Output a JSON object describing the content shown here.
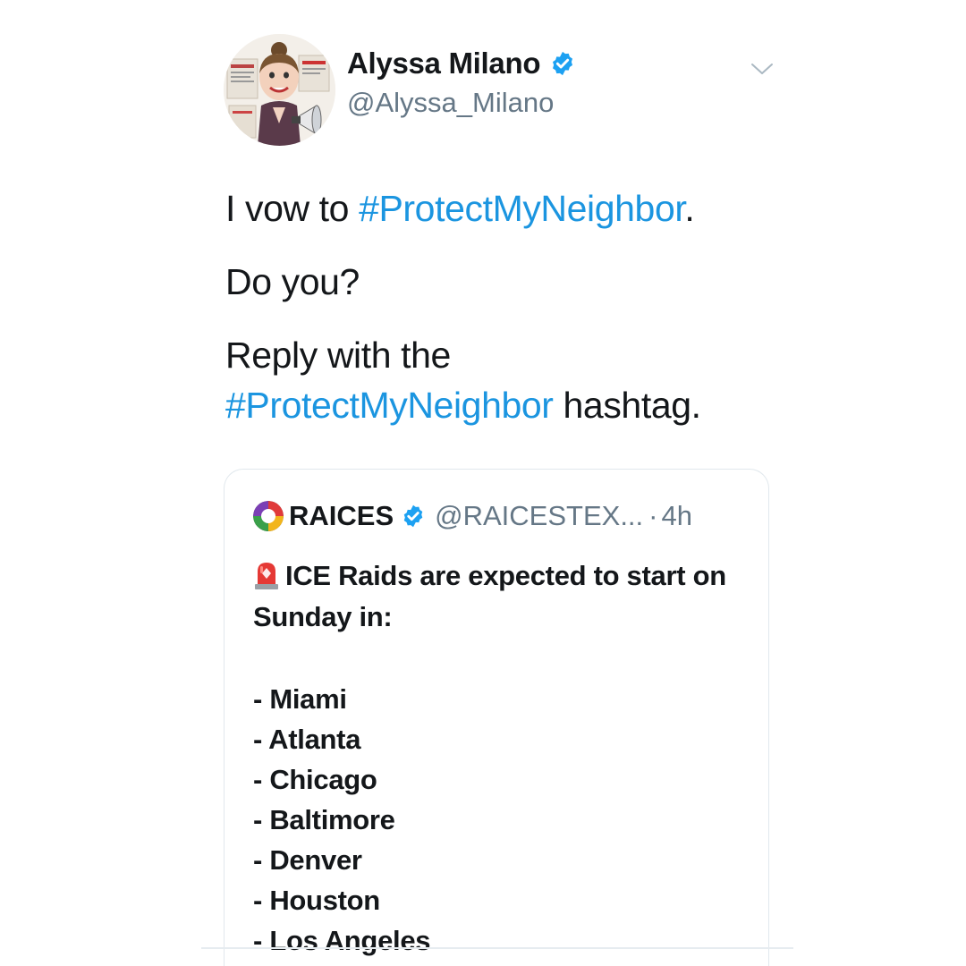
{
  "tweet": {
    "author": {
      "display_name": "Alyssa Milano",
      "handle": "@Alyssa_Milano",
      "avatar_icon": "cartoon-caricature-avatar",
      "verified_icon": "verified-badge-icon"
    },
    "menu_icon": "chevron-down-icon",
    "lines": [
      {
        "before": "I vow to ",
        "hashtag": "#ProtectMyNeighbor",
        "after": "."
      },
      {
        "text": "Do you?"
      },
      {
        "line1": "Reply with the",
        "hashtag": "#ProtectMyNeighbor",
        "after": " hashtag."
      }
    ],
    "quote": {
      "display_name": "RAICES",
      "handle": "@RAICESTEX...",
      "separator": "·",
      "time": "4h",
      "emoji_icon": "police-siren-icon",
      "intro": "ICE Raids are expected to start on Sunday in:",
      "cities": [
        "- Miami",
        "- Atlanta",
        "- Chicago",
        "- Baltimore",
        "- Denver",
        "- Houston",
        "- Los Angeles"
      ]
    }
  },
  "colors": {
    "hashtag": "#1b95e0",
    "secondary_text": "#657786",
    "primary_text": "#14171a",
    "verified": "#1da1f2",
    "border": "#e1e8ed"
  }
}
